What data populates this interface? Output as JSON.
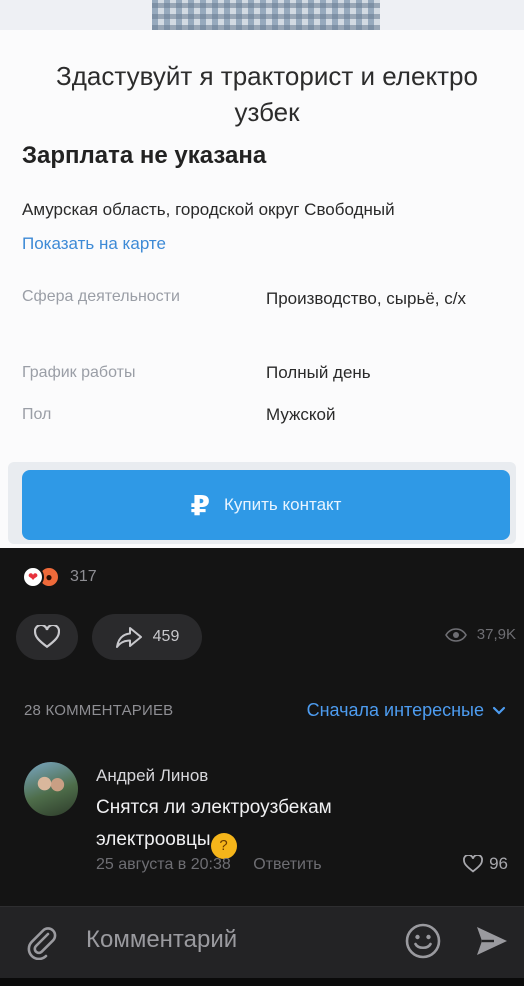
{
  "vacancy": {
    "title": "Здастувуйт я тракторист и електро узбек",
    "salary": "Зарплата не указана",
    "region": "Амурская область, городской округ Свободный",
    "map_link": "Показать на карте",
    "params": [
      {
        "label": "Сфера деятельности",
        "value": "Производство, сырьё, с/х"
      },
      {
        "label": "График работы",
        "value": "Полный день"
      },
      {
        "label": "Пол",
        "value": "Мужской"
      }
    ],
    "buy_button": {
      "icon": "ruble-icon",
      "label": "Купить контакт"
    }
  },
  "post": {
    "reactions": {
      "icons": [
        "heart-reaction",
        "angry-reaction"
      ],
      "count": "317"
    },
    "shares": "459",
    "views": "37,9K"
  },
  "comments": {
    "count_label": "28 КОММЕНТАРИЕВ",
    "sort_label": "Сначала интересные",
    "items": [
      {
        "author": "Андрей Линов",
        "text": "Снятся ли электроузбекам электроовцы",
        "emoji": "thinking-face",
        "date": "25 августа в 20:38",
        "reply_label": "Ответить",
        "likes": "96"
      }
    ]
  },
  "composer": {
    "placeholder": "Комментарий"
  },
  "colors": {
    "accent": "#4d9cf0",
    "buy_button": "#2f99e6",
    "background": "#141414"
  }
}
